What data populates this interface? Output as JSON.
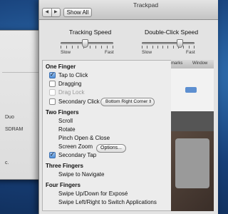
{
  "background_window": {
    "texts": [
      "Duo",
      "SDRAM",
      "c."
    ]
  },
  "window": {
    "title": "Trackpad",
    "nav": {
      "back_icon": "chevron-left",
      "forward_icon": "chevron-right",
      "back_glyph": "◀",
      "forward_glyph": "▶"
    },
    "show_all_label": "Show All"
  },
  "sliders": {
    "tracking": {
      "label": "Tracking Speed",
      "min_label": "Slow",
      "max_label": "Fast",
      "value_fraction": 0.47
    },
    "double_click": {
      "label": "Double-Click Speed",
      "min_label": "Slow",
      "max_label": "Fast",
      "value_fraction": 0.72
    }
  },
  "one_finger": {
    "header": "One Finger",
    "tap_to_click": {
      "label": "Tap to Click",
      "checked": true
    },
    "dragging": {
      "label": "Dragging",
      "checked": false
    },
    "drag_lock": {
      "label": "Drag Lock",
      "checked": false,
      "disabled": true
    },
    "secondary_click": {
      "label": "Secondary Click",
      "checked": false,
      "popup_value": "Bottom Right Corner",
      "popup_arrow": "⇕"
    }
  },
  "two_fingers": {
    "header": "Two Fingers",
    "scroll": "Scroll",
    "rotate": "Rotate",
    "pinch": "Pinch Open & Close",
    "screen_zoom": "Screen Zoom",
    "options_label": "Options...",
    "secondary_tap": {
      "label": "Secondary Tap",
      "checked": true
    }
  },
  "three_fingers": {
    "header": "Three Fingers",
    "swipe": "Swipe to Navigate"
  },
  "four_fingers": {
    "header": "Four Fingers",
    "swipe_updown": "Swipe Up/Down for Exposé",
    "swipe_leftright": "Swipe Left/Right to Switch Applications"
  },
  "preview": {
    "menu_items": [
      "marks",
      "Window"
    ]
  }
}
